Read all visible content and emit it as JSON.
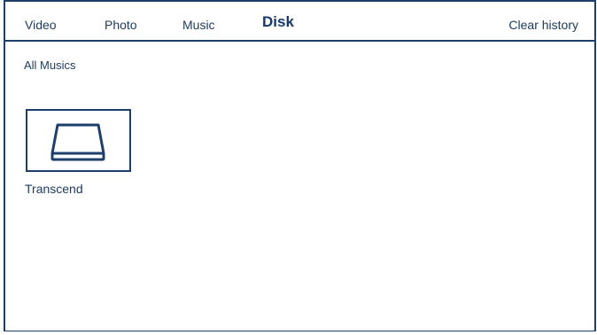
{
  "tabs": [
    {
      "label": "Video",
      "active": false
    },
    {
      "label": "Photo",
      "active": false
    },
    {
      "label": "Music",
      "active": false
    },
    {
      "label": "Disk",
      "active": true
    }
  ],
  "toolbar": {
    "clear_history_label": "Clear history"
  },
  "main": {
    "section_title": "All Musics",
    "devices": [
      {
        "label": "Transcend",
        "icon": "hard-drive-icon",
        "selected": true
      }
    ]
  },
  "colors": {
    "accent": "#1f3f6b",
    "text": "#1b3a5e",
    "background": "#ffffff"
  }
}
